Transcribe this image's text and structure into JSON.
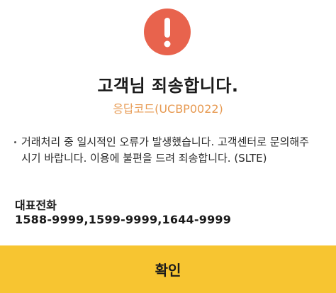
{
  "dialog": {
    "icon": "alert-exclamation-icon",
    "title": "고객님 죄송합니다.",
    "response_code": "응답코드(UCBP0022)",
    "message": "거래처리 중 일시적인 오류가 발생했습니다. 고객센터로 문의해주시기 바랍니다. 이용에 불편을 드려 죄송합니다. (SLTE)",
    "representative_label": "대표전화",
    "representative_numbers": "1588-9999,1599-9999,1644-9999",
    "confirm_label": "확인"
  },
  "colors": {
    "alert_icon": "#e8634d",
    "response_code_text": "#e79a52",
    "confirm_button": "#f7c531"
  }
}
